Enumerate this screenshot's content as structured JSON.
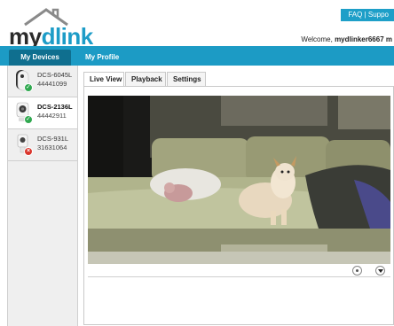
{
  "brand": {
    "logo_my": "my",
    "logo_dlink": "dlink"
  },
  "header": {
    "top_links": "FAQ | Suppo",
    "welcome_prefix": "Welcome, ",
    "welcome_user": "mydlinker6667 m"
  },
  "nav": {
    "my_devices": "My Devices",
    "my_profile": "My Profile"
  },
  "devices": [
    {
      "name": "DCS-6045L",
      "id": "44441099",
      "status": "ok"
    },
    {
      "name": "DCS-2136L",
      "id": "44442911",
      "status": "ok"
    },
    {
      "name": "DCS-931L",
      "id": "31631064",
      "status": "error"
    }
  ],
  "tabs": {
    "live_view": "Live View",
    "playback": "Playback",
    "settings": "Settings"
  },
  "colors": {
    "accent": "#1c9bc5",
    "nav_active": "#0f6f8f",
    "status_ok": "#2fa84f",
    "status_error": "#d9342b"
  }
}
